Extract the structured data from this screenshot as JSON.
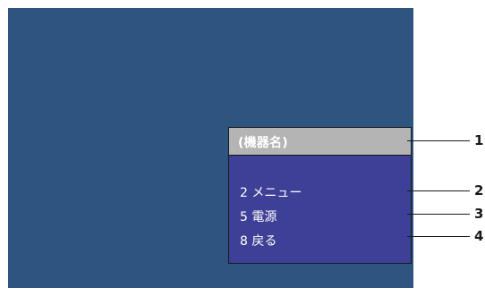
{
  "menu": {
    "title": "(機器名)",
    "items": [
      {
        "label": "2 メニュー"
      },
      {
        "label": "5 電源"
      },
      {
        "label": "8 戻る"
      }
    ]
  },
  "callouts": [
    "1",
    "2",
    "3",
    "4"
  ],
  "colors": {
    "screen_background": "#2e5480",
    "menu_background": "#3e3f96",
    "header_background": "#b4b4b4",
    "text": "#ffffff"
  }
}
